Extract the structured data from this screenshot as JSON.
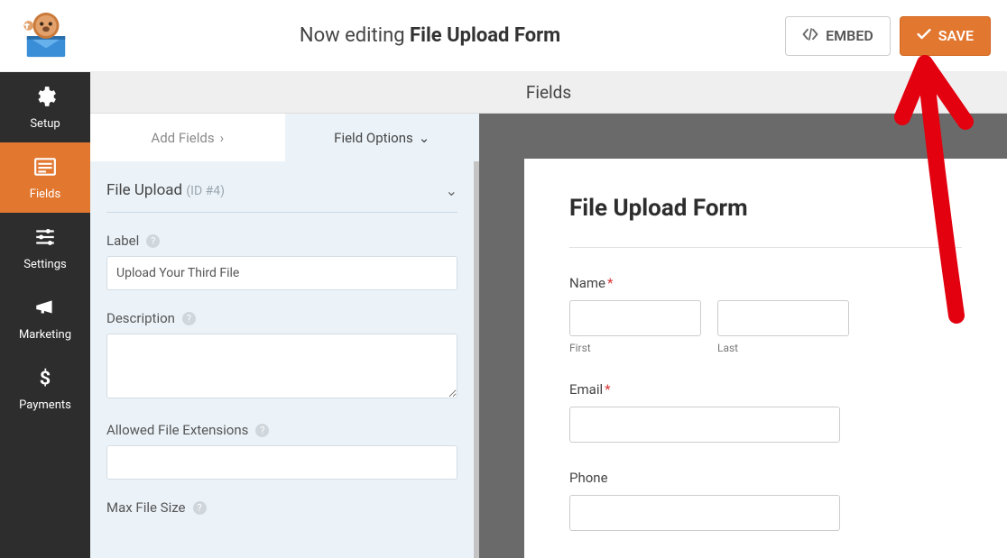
{
  "header": {
    "editing_prefix": "Now editing ",
    "form_name": "File Upload Form",
    "embed_label": "EMBED",
    "save_label": "SAVE"
  },
  "sidebar": {
    "items": [
      {
        "label": "Setup"
      },
      {
        "label": "Fields"
      },
      {
        "label": "Settings"
      },
      {
        "label": "Marketing"
      },
      {
        "label": "Payments"
      }
    ]
  },
  "section_title": "Fields",
  "tabs": {
    "add_fields": "Add Fields",
    "field_options": "Field Options"
  },
  "field_options": {
    "field_type": "File Upload",
    "field_id": "(ID #4)",
    "label_caption": "Label",
    "label_value": "Upload Your Third File",
    "description_caption": "Description",
    "description_value": "",
    "allowed_ext_caption": "Allowed File Extensions",
    "allowed_ext_value": "",
    "max_size_caption": "Max File Size"
  },
  "preview": {
    "form_title": "File Upload Form",
    "name_label": "Name",
    "first_sub": "First",
    "last_sub": "Last",
    "email_label": "Email",
    "phone_label": "Phone",
    "required_marker": "*"
  },
  "colors": {
    "accent": "#e27730"
  }
}
